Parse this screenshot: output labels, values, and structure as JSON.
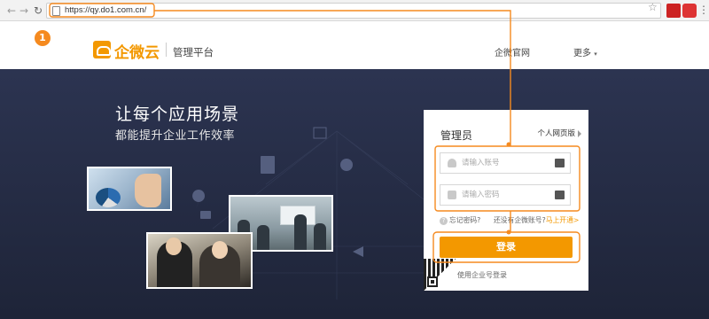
{
  "browser": {
    "url": "https://qy.do1.com.cn/"
  },
  "header": {
    "logo_text": "企微云",
    "logo_subtitle": "管理平台",
    "nav": [
      {
        "label": "企微官网"
      },
      {
        "label": "更多"
      }
    ]
  },
  "hero": {
    "title": "让每个应用场景",
    "subtitle": "都能提升企业工作效率"
  },
  "login": {
    "title": "管理员",
    "switch_label": "个人网页版",
    "account_placeholder": "请输入账号",
    "password_placeholder": "请输入密码",
    "forgot_label": "忘记密码?",
    "no_account_label": "还没有企微账号?",
    "open_now_label": "马上开通>",
    "submit_label": "登录",
    "wechat_login_label": "使用企业号登录"
  },
  "annotation": {
    "step": "1",
    "color": "#f58a1f"
  },
  "colors": {
    "brand": "#f39800",
    "hero_bg": "#262d46"
  }
}
